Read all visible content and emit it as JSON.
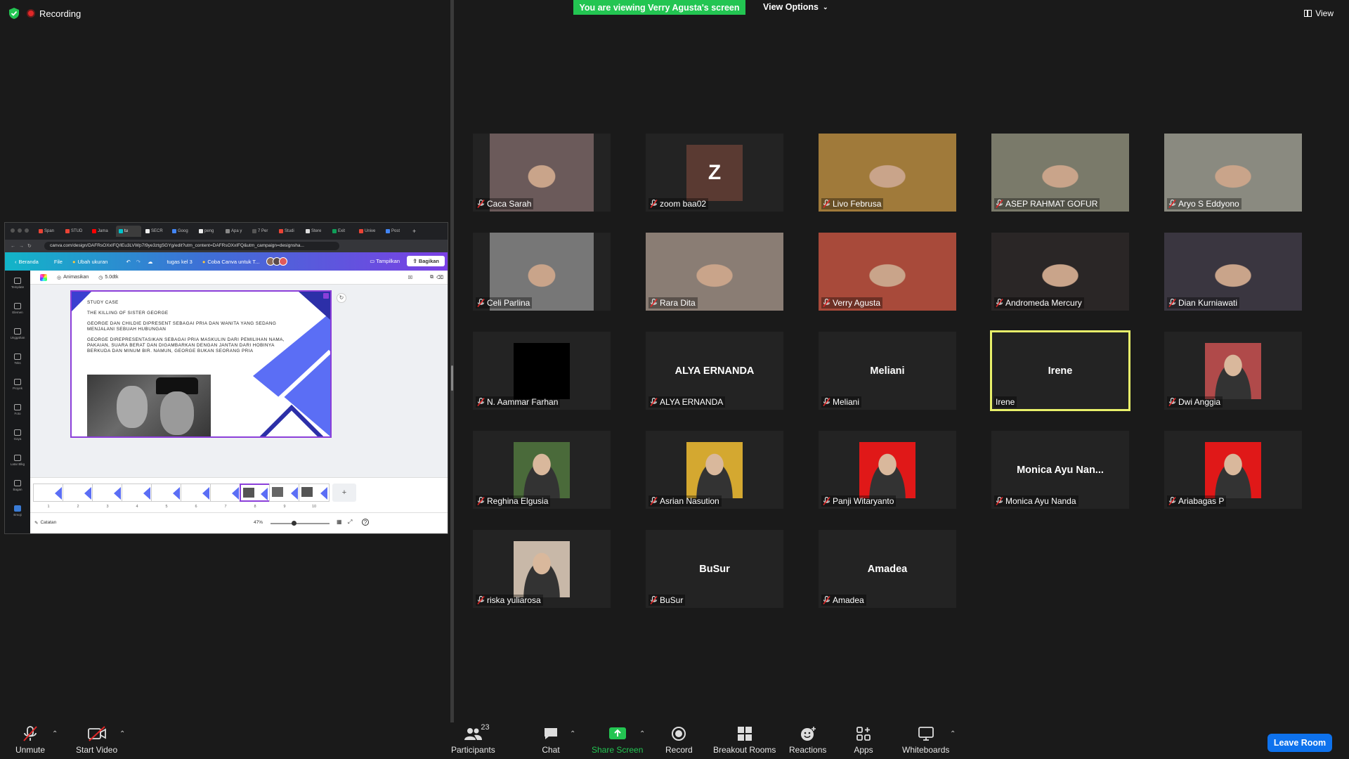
{
  "window": {
    "recording_label": "Recording",
    "viewing_banner": "You are viewing Verry Agusta's screen",
    "view_options_label": "View Options",
    "view_label": "View"
  },
  "shared_screen": {
    "browser_tabs": [
      "Span",
      "STUD",
      "Jama",
      "tu",
      "SECR",
      "Goog",
      "peng",
      "Apa y",
      "7 Per",
      "Studi",
      "Stere",
      "Exit",
      "Unive",
      "Post"
    ],
    "address": "canva.com/design/DAFRsOXxIFQ/lEu3LVWp7I9ye3ztgSGYg/edit?utm_content=DAFRsOXxIFQ&utm_campaign=designsha...",
    "canva_nav": {
      "home": "Beranda",
      "file": "File",
      "resize": "Ubah ukuran",
      "doc_title": "tugas kel 3",
      "try_pro": "Coba Canva untuk T...",
      "present": "Tampilkan",
      "share": "Bagikan"
    },
    "sidebar": [
      "Template",
      "Elemen",
      "Unggahan",
      "Teks",
      "Proyek",
      "Foto",
      "Gaya",
      "Latar Blkg",
      "Bagan",
      "Emoji"
    ],
    "toolbar": {
      "animate": "Animasikan",
      "duration": "5.0dtk"
    },
    "slide": {
      "heading": "STUDY CASE",
      "title": "THE KILLING OF SISTER GEORGE",
      "para1": "GEORGE DAN CHILDIE DIPRESENT SEBAGAI PRIA DAN WANITA YANG SEDANG MENJALANI SEBUAH HUBUNGAN",
      "para2": "GEORGE DIREPRESENTASIKAN SEBAGAI PRIA MASKULIN DARI PEMILIHAN NAMA, PAKAIAN, SUARA BERAT DAN DIGAMBARKAN DENGAN JANTAN DARI HOBINYA BERKUDA DAN MINUM BIR. NAMUN, GEORGE BUKAN SEORANG PRIA"
    },
    "thumbnails": [
      "1",
      "2",
      "3",
      "4",
      "5",
      "6",
      "7",
      "8",
      "9",
      "10"
    ],
    "selected_thumbnail": "8",
    "notes_label": "Catatan",
    "zoom": "47%"
  },
  "participants": [
    {
      "name": "Caca Sarah",
      "type": "video",
      "tone": "#6b5a5a"
    },
    {
      "name": "zoom baa02",
      "type": "initial",
      "initial": "Z",
      "color": "#5a3a32"
    },
    {
      "name": "Livo Februsa",
      "type": "video",
      "tone": "#a07a3a"
    },
    {
      "name": "ASEP RAHMAT GOFUR",
      "type": "video",
      "tone": "#7a7a6a"
    },
    {
      "name": "Aryo S Eddyono",
      "type": "video",
      "tone": "#8a8a80"
    },
    {
      "name": "Celi Parlina",
      "type": "video",
      "tone": "#777777"
    },
    {
      "name": "Rara Dita",
      "type": "video",
      "tone": "#8a7d74"
    },
    {
      "name": "Verry Agusta",
      "type": "video",
      "tone": "#a84a3a"
    },
    {
      "name": "Andromeda Mercury",
      "type": "video",
      "tone": "#2a2626"
    },
    {
      "name": "Dian Kurniawati",
      "type": "video",
      "tone": "#3a3640"
    },
    {
      "name": "N. Aammar Farhan",
      "type": "avatar",
      "color": "#000000"
    },
    {
      "name": "ALYA ERNANDA",
      "type": "name",
      "big": "ALYA ERNANDA"
    },
    {
      "name": "Meliani",
      "type": "name",
      "big": "Meliani"
    },
    {
      "name": "Irene",
      "type": "name",
      "big": "Irene",
      "speaking": true,
      "muted": false
    },
    {
      "name": "Dwi Anggia",
      "type": "avatar",
      "color": "#b04a4a"
    },
    {
      "name": "Reghina Elgusia",
      "type": "avatar",
      "color": "#4a6a3a"
    },
    {
      "name": "Asrian Nasution",
      "type": "avatar",
      "color": "#d4a830"
    },
    {
      "name": "Panji Witaryanto",
      "type": "avatar",
      "color": "#e01818"
    },
    {
      "name": "Monica Ayu Nanda",
      "type": "name",
      "big": "Monica  Ayu  Nan..."
    },
    {
      "name": "Ariabagas P",
      "type": "avatar",
      "color": "#e01818"
    },
    {
      "name": "riska yuliarosa",
      "type": "avatar",
      "color": "#c8b8a8"
    },
    {
      "name": "BuSur",
      "type": "name",
      "big": "BuSur"
    },
    {
      "name": "Amadea",
      "type": "name",
      "big": "Amadea"
    }
  ],
  "toolbar": {
    "unmute": "Unmute",
    "start_video": "Start Video",
    "participants": "Participants",
    "participant_count": "23",
    "chat": "Chat",
    "share_screen": "Share Screen",
    "record": "Record",
    "breakout_rooms": "Breakout Rooms",
    "reactions": "Reactions",
    "apps": "Apps",
    "whiteboards": "Whiteboards",
    "leave_room": "Leave Room"
  },
  "colors": {
    "zoom_green": "#23c552",
    "leave_blue": "#0e72ed",
    "speaking_outline": "#e8f06a",
    "canva_purple": "#8b3fd9",
    "slide_blue": "#5b6ef5"
  }
}
